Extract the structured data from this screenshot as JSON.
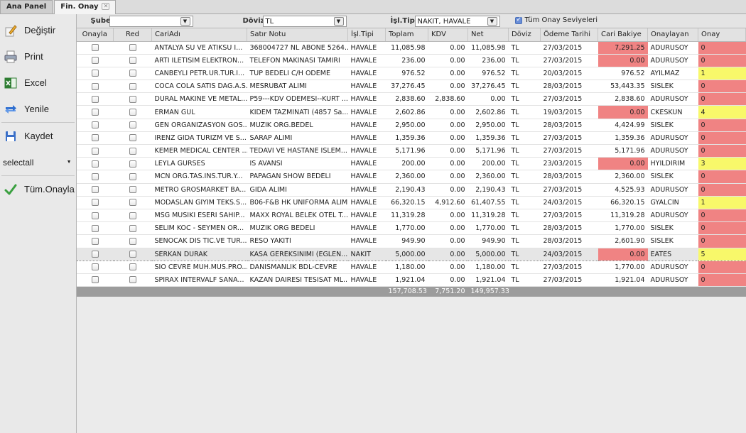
{
  "tabs": [
    {
      "label": "Ana Panel",
      "active": false
    },
    {
      "label": "Fin. Onay",
      "active": true,
      "close": "✕"
    }
  ],
  "sidebar": {
    "items": [
      {
        "label": "Değiştir",
        "icon": "edit-icon"
      },
      {
        "label": "Print",
        "icon": "printer-icon"
      },
      {
        "label": "Excel",
        "icon": "excel-icon"
      },
      {
        "label": "Yenile",
        "icon": "refresh-icon"
      },
      {
        "label": "Kaydet",
        "icon": "save-icon"
      }
    ],
    "select_label": "selectall",
    "approve_all": "Tüm.Onayla"
  },
  "filters": {
    "sube_label": "Şube",
    "sube_value": "",
    "doviz_label": "Döviz",
    "doviz_value": "TL",
    "isl_tipi_label": "İşl.Tipi",
    "isl_tipi_value": "NAKIT, HAVALE",
    "tum_onay_label": "Tüm Onay Seviyeleri",
    "tum_onay_checked": true
  },
  "table": {
    "columns": [
      "Onayla",
      "Red",
      "CariAdı",
      "Satır Notu",
      "İşl.Tipi",
      "Toplam",
      "KDV",
      "Net",
      "Döviz",
      "Ödeme Tarihi",
      "Cari Bakiye",
      "Onaylayan",
      "Onay"
    ],
    "rows": [
      {
        "cari": "ANTALYA SU VE ATIKSU I...",
        "not": "368004727 NL ABONE 5264...",
        "tip": "HAVALE",
        "toplam": "11,085.98",
        "kdv": "0.00",
        "net": "11,085.98",
        "doviz": "TL",
        "tarih": "27/03/2015",
        "bakiye": "7,291.25",
        "bakiye_red": true,
        "onaylayan": "ADURUSOY",
        "onay": "0",
        "onay_color": "red"
      },
      {
        "cari": "ARTI ILETISIM ELEKTRON...",
        "not": "TELEFON MAKINASI TAMIRI",
        "tip": "HAVALE",
        "toplam": "236.00",
        "kdv": "0.00",
        "net": "236.00",
        "doviz": "TL",
        "tarih": "27/03/2015",
        "bakiye": "0.00",
        "bakiye_red": true,
        "onaylayan": "ADURUSOY",
        "onay": "0",
        "onay_color": "red"
      },
      {
        "cari": "CANBEYLI PETR.UR.TUR.I...",
        "not": "TUP BEDELI C/H ODEME",
        "tip": "HAVALE",
        "toplam": "976.52",
        "kdv": "0.00",
        "net": "976.52",
        "doviz": "TL",
        "tarih": "20/03/2015",
        "bakiye": "976.52",
        "bakiye_red": false,
        "onaylayan": "AYILMAZ",
        "onay": "1",
        "onay_color": "yellow"
      },
      {
        "cari": "COCA COLA SATIS DAG.A.S.",
        "not": "MESRUBAT ALIMI",
        "tip": "HAVALE",
        "toplam": "37,276.45",
        "kdv": "0.00",
        "net": "37,276.45",
        "doviz": "TL",
        "tarih": "28/03/2015",
        "bakiye": "53,443.35",
        "bakiye_red": false,
        "onaylayan": "SISLEK",
        "onay": "0",
        "onay_color": "red"
      },
      {
        "cari": "DURAL MAKINE VE METAL...",
        "not": "P59---KDV ODEMESI--KURT ...",
        "tip": "HAVALE",
        "toplam": "2,838.60",
        "kdv": "2,838.60",
        "net": "0.00",
        "doviz": "TL",
        "tarih": "27/03/2015",
        "bakiye": "2,838.60",
        "bakiye_red": false,
        "onaylayan": "ADURUSOY",
        "onay": "0",
        "onay_color": "red"
      },
      {
        "cari": "ERMAN GUL",
        "not": "KIDEM TAZMINATI (4857 Sa...",
        "tip": "HAVALE",
        "toplam": "2,602.86",
        "kdv": "0.00",
        "net": "2,602.86",
        "doviz": "TL",
        "tarih": "19/03/2015",
        "bakiye": "0.00",
        "bakiye_red": true,
        "onaylayan": "CKESKUN",
        "onay": "4",
        "onay_color": "yellow"
      },
      {
        "cari": "GEN ORGANIZASYON GOS...",
        "not": "MUZIK ORG.BEDEL",
        "tip": "HAVALE",
        "toplam": "2,950.00",
        "kdv": "0.00",
        "net": "2,950.00",
        "doviz": "TL",
        "tarih": "28/03/2015",
        "bakiye": "4,424.99",
        "bakiye_red": false,
        "onaylayan": "SISLEK",
        "onay": "0",
        "onay_color": "red"
      },
      {
        "cari": "IRENZ GIDA TURIZM VE S...",
        "not": "SARAP ALIMI",
        "tip": "HAVALE",
        "toplam": "1,359.36",
        "kdv": "0.00",
        "net": "1,359.36",
        "doviz": "TL",
        "tarih": "27/03/2015",
        "bakiye": "1,359.36",
        "bakiye_red": false,
        "onaylayan": "ADURUSOY",
        "onay": "0",
        "onay_color": "red"
      },
      {
        "cari": "KEMER MEDICAL CENTER ...",
        "not": "TEDAVI VE HASTANE ISLEM...",
        "tip": "HAVALE",
        "toplam": "5,171.96",
        "kdv": "0.00",
        "net": "5,171.96",
        "doviz": "TL",
        "tarih": "27/03/2015",
        "bakiye": "5,171.96",
        "bakiye_red": false,
        "onaylayan": "ADURUSOY",
        "onay": "0",
        "onay_color": "red"
      },
      {
        "cari": "LEYLA GURSES",
        "not": "IS AVANSI",
        "tip": "HAVALE",
        "toplam": "200.00",
        "kdv": "0.00",
        "net": "200.00",
        "doviz": "TL",
        "tarih": "23/03/2015",
        "bakiye": "0.00",
        "bakiye_red": true,
        "onaylayan": "HYILDIRIM",
        "onay": "3",
        "onay_color": "yellow"
      },
      {
        "cari": "MCN ORG.TAS.INS.TUR.Y...",
        "not": "PAPAGAN SHOW BEDELI",
        "tip": "HAVALE",
        "toplam": "2,360.00",
        "kdv": "0.00",
        "net": "2,360.00",
        "doviz": "TL",
        "tarih": "28/03/2015",
        "bakiye": "2,360.00",
        "bakiye_red": false,
        "onaylayan": "SISLEK",
        "onay": "0",
        "onay_color": "red"
      },
      {
        "cari": "METRO GROSMARKET BA...",
        "not": "GIDA ALIMI",
        "tip": "HAVALE",
        "toplam": "2,190.43",
        "kdv": "0.00",
        "net": "2,190.43",
        "doviz": "TL",
        "tarih": "27/03/2015",
        "bakiye": "4,525.93",
        "bakiye_red": false,
        "onaylayan": "ADURUSOY",
        "onay": "0",
        "onay_color": "red"
      },
      {
        "cari": "MODASLAN GIYIM TEKS.S...",
        "not": "B06-F&B HK UNIFORMA ALIMI",
        "tip": "HAVALE",
        "toplam": "66,320.15",
        "kdv": "4,912.60",
        "net": "61,407.55",
        "doviz": "TL",
        "tarih": "24/03/2015",
        "bakiye": "66,320.15",
        "bakiye_red": false,
        "onaylayan": "GYALCIN",
        "onay": "1",
        "onay_color": "yellow"
      },
      {
        "cari": "MSG MUSIKI ESERI SAHIP...",
        "not": "MAXX ROYAL BELEK OTEL T...",
        "tip": "HAVALE",
        "toplam": "11,319.28",
        "kdv": "0.00",
        "net": "11,319.28",
        "doviz": "TL",
        "tarih": "27/03/2015",
        "bakiye": "11,319.28",
        "bakiye_red": false,
        "onaylayan": "ADURUSOY",
        "onay": "0",
        "onay_color": "red"
      },
      {
        "cari": "SELIM KOC - SEYMEN OR...",
        "not": "MUZIK ORG BEDELI",
        "tip": "HAVALE",
        "toplam": "1,770.00",
        "kdv": "0.00",
        "net": "1,770.00",
        "doviz": "TL",
        "tarih": "28/03/2015",
        "bakiye": "1,770.00",
        "bakiye_red": false,
        "onaylayan": "SISLEK",
        "onay": "0",
        "onay_color": "red"
      },
      {
        "cari": "SENOCAK DIS TIC.VE TUR...",
        "not": "RESO YAKITI",
        "tip": "HAVALE",
        "toplam": "949.90",
        "kdv": "0.00",
        "net": "949.90",
        "doviz": "TL",
        "tarih": "28/03/2015",
        "bakiye": "2,601.90",
        "bakiye_red": false,
        "onaylayan": "SISLEK",
        "onay": "0",
        "onay_color": "red"
      },
      {
        "cari": "SERKAN DURAK",
        "not": "KASA GEREKSINIMI (EGLEN...",
        "tip": "NAKIT",
        "toplam": "5,000.00",
        "kdv": "0.00",
        "net": "5,000.00",
        "doviz": "TL",
        "tarih": "24/03/2015",
        "bakiye": "0.00",
        "bakiye_red": true,
        "onaylayan": "EATES",
        "onay": "5",
        "onay_color": "yellow",
        "selected": true
      },
      {
        "cari": "SIO CEVRE MUH.MUS.PRO...",
        "not": "DANISMANLIK BDL-CEVRE",
        "tip": "HAVALE",
        "toplam": "1,180.00",
        "kdv": "0.00",
        "net": "1,180.00",
        "doviz": "TL",
        "tarih": "27/03/2015",
        "bakiye": "1,770.00",
        "bakiye_red": false,
        "onaylayan": "ADURUSOY",
        "onay": "0",
        "onay_color": "red"
      },
      {
        "cari": "SPIRAX INTERVALF SANA...",
        "not": "KAZAN DAIRESI TESISAT ML...",
        "tip": "HAVALE",
        "toplam": "1,921.04",
        "kdv": "0.00",
        "net": "1,921.04",
        "doviz": "TL",
        "tarih": "27/03/2015",
        "bakiye": "1,921.04",
        "bakiye_red": false,
        "onaylayan": "ADURUSOY",
        "onay": "0",
        "onay_color": "red"
      }
    ],
    "totals": {
      "toplam": "157,708.53",
      "kdv": "7,751.20",
      "net": "149,957.33"
    }
  },
  "colors": {
    "red": "#f08383",
    "yellow": "#f8f86a"
  }
}
